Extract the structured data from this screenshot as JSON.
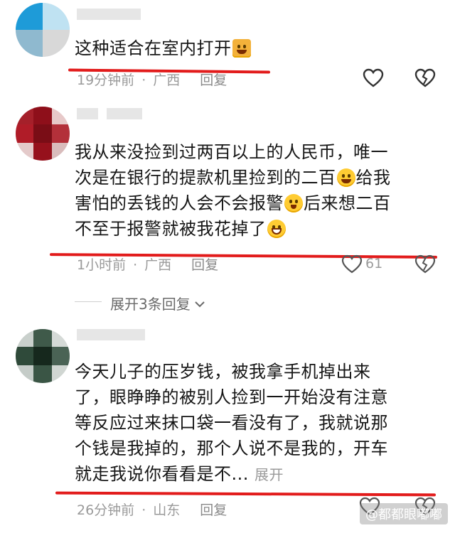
{
  "comments": [
    {
      "text_lines": [
        "这种适合在室内打开"
      ],
      "time": "19分钟前",
      "location": "广西",
      "reply": "回复",
      "likes": ""
    },
    {
      "text_lines": [
        "我从来没捡到过两百以上的人民币，唯一",
        "次是在银行的提款机里捡到的二百",
        "给我",
        "害怕的丢钱的人会不会报警",
        "后来想二百",
        "不至于报警就被我花掉了"
      ],
      "time": "1小时前",
      "location": "广西",
      "reply": "回复",
      "likes": "61",
      "expand": "展开3条回复"
    },
    {
      "text_lines": [
        "今天儿子的压岁钱，被我拿手机掉出来",
        "了，眼睁睁的被别人捡到一开始没有注意",
        "等反应过来抹口袋一看没有了，我就说那",
        "个钱是我掉的，那个人说不是我的，开车",
        "就走我说你看看是不..."
      ],
      "more": "展开",
      "time": "26分钟前",
      "location": "山东",
      "reply": "回复",
      "likes": ""
    }
  ],
  "watermark": "@都都眼嘟嘟",
  "colors": {
    "underline": "#e21b1b",
    "meta": "#9a9a9a"
  }
}
